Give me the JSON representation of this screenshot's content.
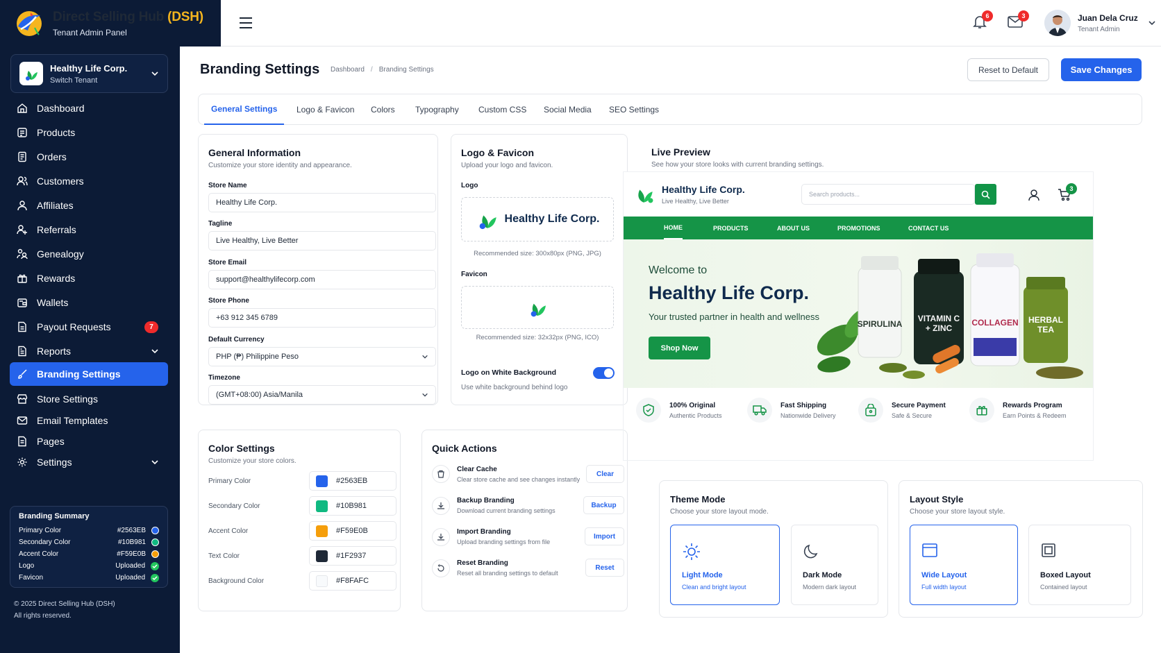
{
  "app": {
    "title_main": "Direct Selling Hub",
    "title_accent": "(DSH)",
    "subtitle": "Tenant Admin Panel"
  },
  "tenant": {
    "name": "Healthy Life Corp.",
    "action": "Switch Tenant"
  },
  "sidebar": {
    "items": [
      {
        "label": "Dashboard",
        "icon": "home-icon"
      },
      {
        "label": "Products",
        "icon": "products-icon"
      },
      {
        "label": "Orders",
        "icon": "orders-icon"
      },
      {
        "label": "Customers",
        "icon": "customers-icon"
      },
      {
        "label": "Affiliates",
        "icon": "affiliates-icon"
      },
      {
        "label": "Referrals",
        "icon": "referrals-icon"
      },
      {
        "label": "Genealogy",
        "icon": "genealogy-icon"
      },
      {
        "label": "Rewards",
        "icon": "gift-icon"
      },
      {
        "label": "Wallets",
        "icon": "wallet-icon"
      },
      {
        "label": "Payout Requests",
        "icon": "payout-icon",
        "badge": "7"
      },
      {
        "label": "Reports",
        "icon": "reports-icon"
      },
      {
        "label": "Branding Settings",
        "icon": "brush-icon"
      },
      {
        "label": "Store Settings",
        "icon": "store-icon"
      },
      {
        "label": "Email Templates",
        "icon": "mail-icon"
      },
      {
        "label": "Pages",
        "icon": "pages-icon"
      },
      {
        "label": "Settings",
        "icon": "gear-icon"
      }
    ]
  },
  "summary": {
    "title": "Branding Summary",
    "rows": [
      {
        "label": "Primary Color",
        "value": "#2563EB",
        "color": "#2563EB"
      },
      {
        "label": "Secondary Color",
        "value": "#10B981",
        "color": "#10B981"
      },
      {
        "label": "Accent Color",
        "value": "#F59E0B",
        "color": "#F59E0B"
      },
      {
        "label": "Logo",
        "value": "Uploaded",
        "color": "#22c55e"
      },
      {
        "label": "Favicon",
        "value": "Uploaded",
        "color": "#22c55e"
      }
    ]
  },
  "footer": {
    "copyright": "© 2025 Direct Selling Hub (DSH)",
    "rights": "All rights reserved."
  },
  "topbar": {
    "notifications": "6",
    "messages": "3",
    "user_name": "Juan Dela Cruz",
    "user_role": "Tenant Admin"
  },
  "page": {
    "title": "Branding Settings",
    "breadcrumb": [
      "Dashboard",
      "Branding Settings"
    ],
    "reset_label": "Reset to Default",
    "save_label": "Save Changes"
  },
  "tabs": [
    "General Settings",
    "Logo & Favicon",
    "Colors",
    "Typography",
    "Custom CSS",
    "Social Media",
    "SEO Settings"
  ],
  "general": {
    "title": "General Information",
    "subtitle": "Customize your store identity and appearance.",
    "fields": [
      {
        "label": "Store Name",
        "value": "Healthy Life Corp."
      },
      {
        "label": "Tagline",
        "value": "Live Healthy, Live Better"
      },
      {
        "label": "Store Email",
        "value": "support@healthylifecorp.com"
      },
      {
        "label": "Store Phone",
        "value": "+63 912 345 6789"
      },
      {
        "label": "Default Currency",
        "value": "PHP (₱) Philippine Peso"
      },
      {
        "label": "Timezone",
        "value": "(GMT+08:00) Asia/Manila"
      }
    ]
  },
  "logo": {
    "title": "Logo & Favicon",
    "subtitle": "Upload your logo and favicon.",
    "logo_label": "Logo",
    "logo_text": "Healthy Life Corp.",
    "logo_hint": "Recommended size: 300x80px (PNG, JPG)",
    "favicon_label": "Favicon",
    "favicon_hint": "Recommended size: 32x32px (PNG, ICO)",
    "white_bg_label": "Logo on White Background",
    "white_bg_desc": "Use white background behind logo",
    "white_bg_on": true
  },
  "colors": {
    "title": "Color Settings",
    "subtitle": "Customize your store colors.",
    "items": [
      {
        "label": "Primary Color",
        "value": "#2563EB",
        "color": "#2563EB"
      },
      {
        "label": "Secondary Color",
        "value": "#10B981",
        "color": "#10B981"
      },
      {
        "label": "Accent Color",
        "value": "#F59E0B",
        "color": "#F59E0B"
      },
      {
        "label": "Text Color",
        "value": "#1F2937",
        "color": "#1F2937"
      },
      {
        "label": "Background Color",
        "value": "#F8FAFC",
        "color": "#F8FAFC"
      }
    ]
  },
  "quick": {
    "title": "Quick Actions",
    "items": [
      {
        "title": "Clear Cache",
        "desc": "Clear store cache and see changes instantly",
        "button": "Clear",
        "icon": "cache-icon"
      },
      {
        "title": "Backup Branding",
        "desc": "Download current branding settings",
        "button": "Backup",
        "icon": "download-icon"
      },
      {
        "title": "Import Branding",
        "desc": "Upload branding settings from file",
        "button": "Import",
        "icon": "import-icon"
      },
      {
        "title": "Reset Branding",
        "desc": "Reset all branding settings to default",
        "button": "Reset",
        "icon": "reset-icon"
      }
    ]
  },
  "preview": {
    "title": "Live Preview",
    "subtitle": "See how your store looks with current branding settings.",
    "store_name": "Healthy Life Corp.",
    "store_tagline": "Live Healthy, Live Better",
    "search_placeholder": "Search products...",
    "cart_count": "3",
    "nav": [
      "HOME",
      "PRODUCTS",
      "ABOUT US",
      "PROMOTIONS",
      "CONTACT US"
    ],
    "hero": {
      "welcome": "Welcome to",
      "name": "Healthy Life Corp.",
      "sub": "Your trusted partner in health and wellness",
      "cta": "Shop Now"
    },
    "products": [
      {
        "line1": "SPIRULINA",
        "line2": ""
      },
      {
        "line1": "VITAMIN C",
        "line2": "+ ZINC"
      },
      {
        "line1": "COLLAGEN",
        "line2": ""
      },
      {
        "line1": "HERBAL",
        "line2": "TEA"
      }
    ],
    "features": [
      {
        "title": "100% Original",
        "sub": "Authentic Products"
      },
      {
        "title": "Fast Shipping",
        "sub": "Nationwide Delivery"
      },
      {
        "title": "Secure Payment",
        "sub": "Safe & Secure"
      },
      {
        "title": "Rewards Program",
        "sub": "Earn Points & Redeem"
      }
    ]
  },
  "theme": {
    "title": "Theme Mode",
    "subtitle": "Choose your store layout mode.",
    "options": [
      {
        "title": "Light Mode",
        "sub": "Clean and bright layout"
      },
      {
        "title": "Dark Mode",
        "sub": "Modern dark layout"
      }
    ]
  },
  "layout": {
    "title": "Layout Style",
    "subtitle": "Choose your store layout style.",
    "options": [
      {
        "title": "Wide Layout",
        "sub": "Full width layout"
      },
      {
        "title": "Boxed Layout",
        "sub": "Contained layout"
      }
    ]
  }
}
